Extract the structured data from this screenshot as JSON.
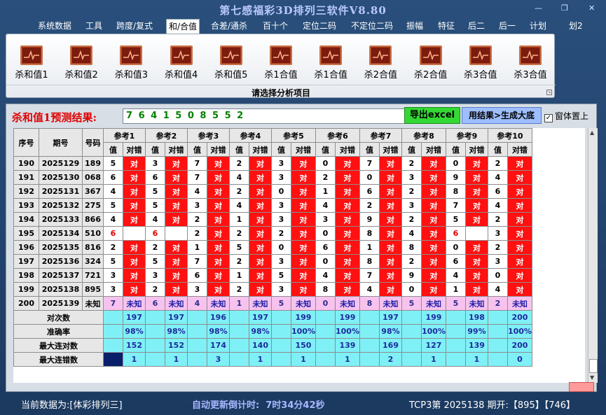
{
  "window": {
    "title": "第七感福彩3D排列三软件V8.80",
    "btn_min": "—",
    "btn_max": "❐",
    "btn_close": "✕"
  },
  "menu": [
    "系统数据",
    "工具",
    "跨度/复式",
    "和/合值",
    "合差/通杀",
    "百十个",
    "定位二码",
    "不定位二码",
    "振幅",
    "特征",
    "后二",
    "后一",
    "计划",
    "划2"
  ],
  "menu_active": "和/合值",
  "ribbon": {
    "items": [
      "杀和值1",
      "杀和值2",
      "杀和值3",
      "杀和值4",
      "杀和值5",
      "杀1合值",
      "杀1合值",
      "杀2合值",
      "杀2合值",
      "杀3合值",
      "杀3合值"
    ],
    "icon": "pulse-chart-icon",
    "caption": "请选择分析项目"
  },
  "panel": {
    "prediction_label": "杀和值1预测结果:",
    "prediction_value": "7 6 4 1 5 0 8 5 5 2",
    "export_button": "导出excel",
    "generate_button": "用结果>生成大底",
    "topmost_label": "窗体置上",
    "topmost_checked": "✓"
  },
  "table": {
    "headers": {
      "seq": "序号",
      "period": "期号",
      "number": "号码",
      "val": "值",
      "judge": "对错"
    },
    "refs": [
      "参考1",
      "参考2",
      "参考3",
      "参考4",
      "参考5",
      "参考6",
      "参考7",
      "参考8",
      "参考9",
      "参考10"
    ],
    "right_text": "对",
    "unknown_text": "未知",
    "rows": [
      {
        "seq": "190",
        "period": "2025129",
        "number": "189",
        "vals": [
          "5",
          "3",
          "7",
          "2",
          "3",
          "0",
          "7",
          "2",
          "0",
          "2"
        ],
        "ok": [
          1,
          1,
          1,
          1,
          1,
          1,
          1,
          1,
          1,
          1
        ]
      },
      {
        "seq": "191",
        "period": "2025130",
        "number": "068",
        "vals": [
          "6",
          "6",
          "7",
          "4",
          "3",
          "2",
          "0",
          "3",
          "9",
          "4"
        ],
        "ok": [
          1,
          1,
          1,
          1,
          1,
          1,
          1,
          1,
          1,
          1
        ]
      },
      {
        "seq": "192",
        "period": "2025131",
        "number": "367",
        "vals": [
          "4",
          "5",
          "4",
          "2",
          "0",
          "1",
          "6",
          "2",
          "8",
          "6"
        ],
        "ok": [
          1,
          1,
          1,
          1,
          1,
          1,
          1,
          1,
          1,
          1
        ]
      },
      {
        "seq": "193",
        "period": "2025132",
        "number": "275",
        "vals": [
          "5",
          "5",
          "3",
          "4",
          "3",
          "4",
          "2",
          "3",
          "7",
          "4"
        ],
        "ok": [
          1,
          1,
          1,
          1,
          1,
          1,
          1,
          1,
          1,
          1
        ]
      },
      {
        "seq": "194",
        "period": "2025133",
        "number": "866",
        "vals": [
          "4",
          "4",
          "2",
          "1",
          "3",
          "3",
          "9",
          "2",
          "5",
          "2"
        ],
        "ok": [
          1,
          1,
          1,
          1,
          1,
          1,
          1,
          1,
          1,
          1
        ]
      },
      {
        "seq": "195",
        "period": "2025134",
        "number": "510",
        "vals": [
          "6",
          "6",
          "2",
          "2",
          "2",
          "0",
          "8",
          "4",
          "6",
          "3"
        ],
        "ok": [
          0,
          0,
          1,
          1,
          1,
          1,
          1,
          1,
          0,
          1
        ]
      },
      {
        "seq": "196",
        "period": "2025135",
        "number": "816",
        "vals": [
          "2",
          "2",
          "1",
          "5",
          "0",
          "6",
          "1",
          "8",
          "0",
          "2"
        ],
        "ok": [
          1,
          1,
          1,
          1,
          1,
          1,
          1,
          1,
          1,
          1
        ]
      },
      {
        "seq": "197",
        "period": "2025136",
        "number": "324",
        "vals": [
          "5",
          "5",
          "7",
          "2",
          "3",
          "0",
          "8",
          "2",
          "6",
          "3"
        ],
        "ok": [
          1,
          1,
          1,
          1,
          1,
          1,
          1,
          1,
          1,
          1
        ]
      },
      {
        "seq": "198",
        "period": "2025137",
        "number": "721",
        "vals": [
          "3",
          "3",
          "6",
          "1",
          "5",
          "4",
          "7",
          "9",
          "4",
          "0"
        ],
        "ok": [
          1,
          1,
          1,
          1,
          1,
          1,
          1,
          1,
          1,
          1
        ]
      },
      {
        "seq": "199",
        "period": "2025138",
        "number": "895",
        "vals": [
          "3",
          "2",
          "3",
          "2",
          "3",
          "8",
          "4",
          "0",
          "1",
          "4"
        ],
        "ok": [
          1,
          1,
          1,
          1,
          1,
          1,
          1,
          1,
          1,
          1
        ]
      }
    ],
    "pending": {
      "seq": "200",
      "period": "2025139",
      "number": "未知",
      "vals": [
        "7",
        "6",
        "4",
        "1",
        "5",
        "0",
        "8",
        "5",
        "5",
        "2"
      ]
    },
    "stats": [
      {
        "label": "对次数",
        "vals": [
          "197",
          "197",
          "196",
          "197",
          "199",
          "199",
          "197",
          "199",
          "198",
          "200"
        ]
      },
      {
        "label": "准确率",
        "vals": [
          "98%",
          "98%",
          "98%",
          "98%",
          "100%",
          "100%",
          "98%",
          "100%",
          "99%",
          "100%"
        ]
      },
      {
        "label": "最大连对数",
        "vals": [
          "152",
          "152",
          "174",
          "140",
          "150",
          "139",
          "169",
          "127",
          "139",
          "200"
        ]
      },
      {
        "label": "最大连错数",
        "vals": [
          "1",
          "1",
          "3",
          "1",
          "1",
          "1",
          "2",
          "1",
          "1",
          "0"
        ]
      }
    ]
  },
  "statusbar": {
    "current_data": "当前数据为:[体彩排列三]",
    "countdown_label": "自动更新倒计时:",
    "countdown_value": "7时34分42秒",
    "last_draw": "TCP3第 2025138 期开:【895】【746】"
  }
}
